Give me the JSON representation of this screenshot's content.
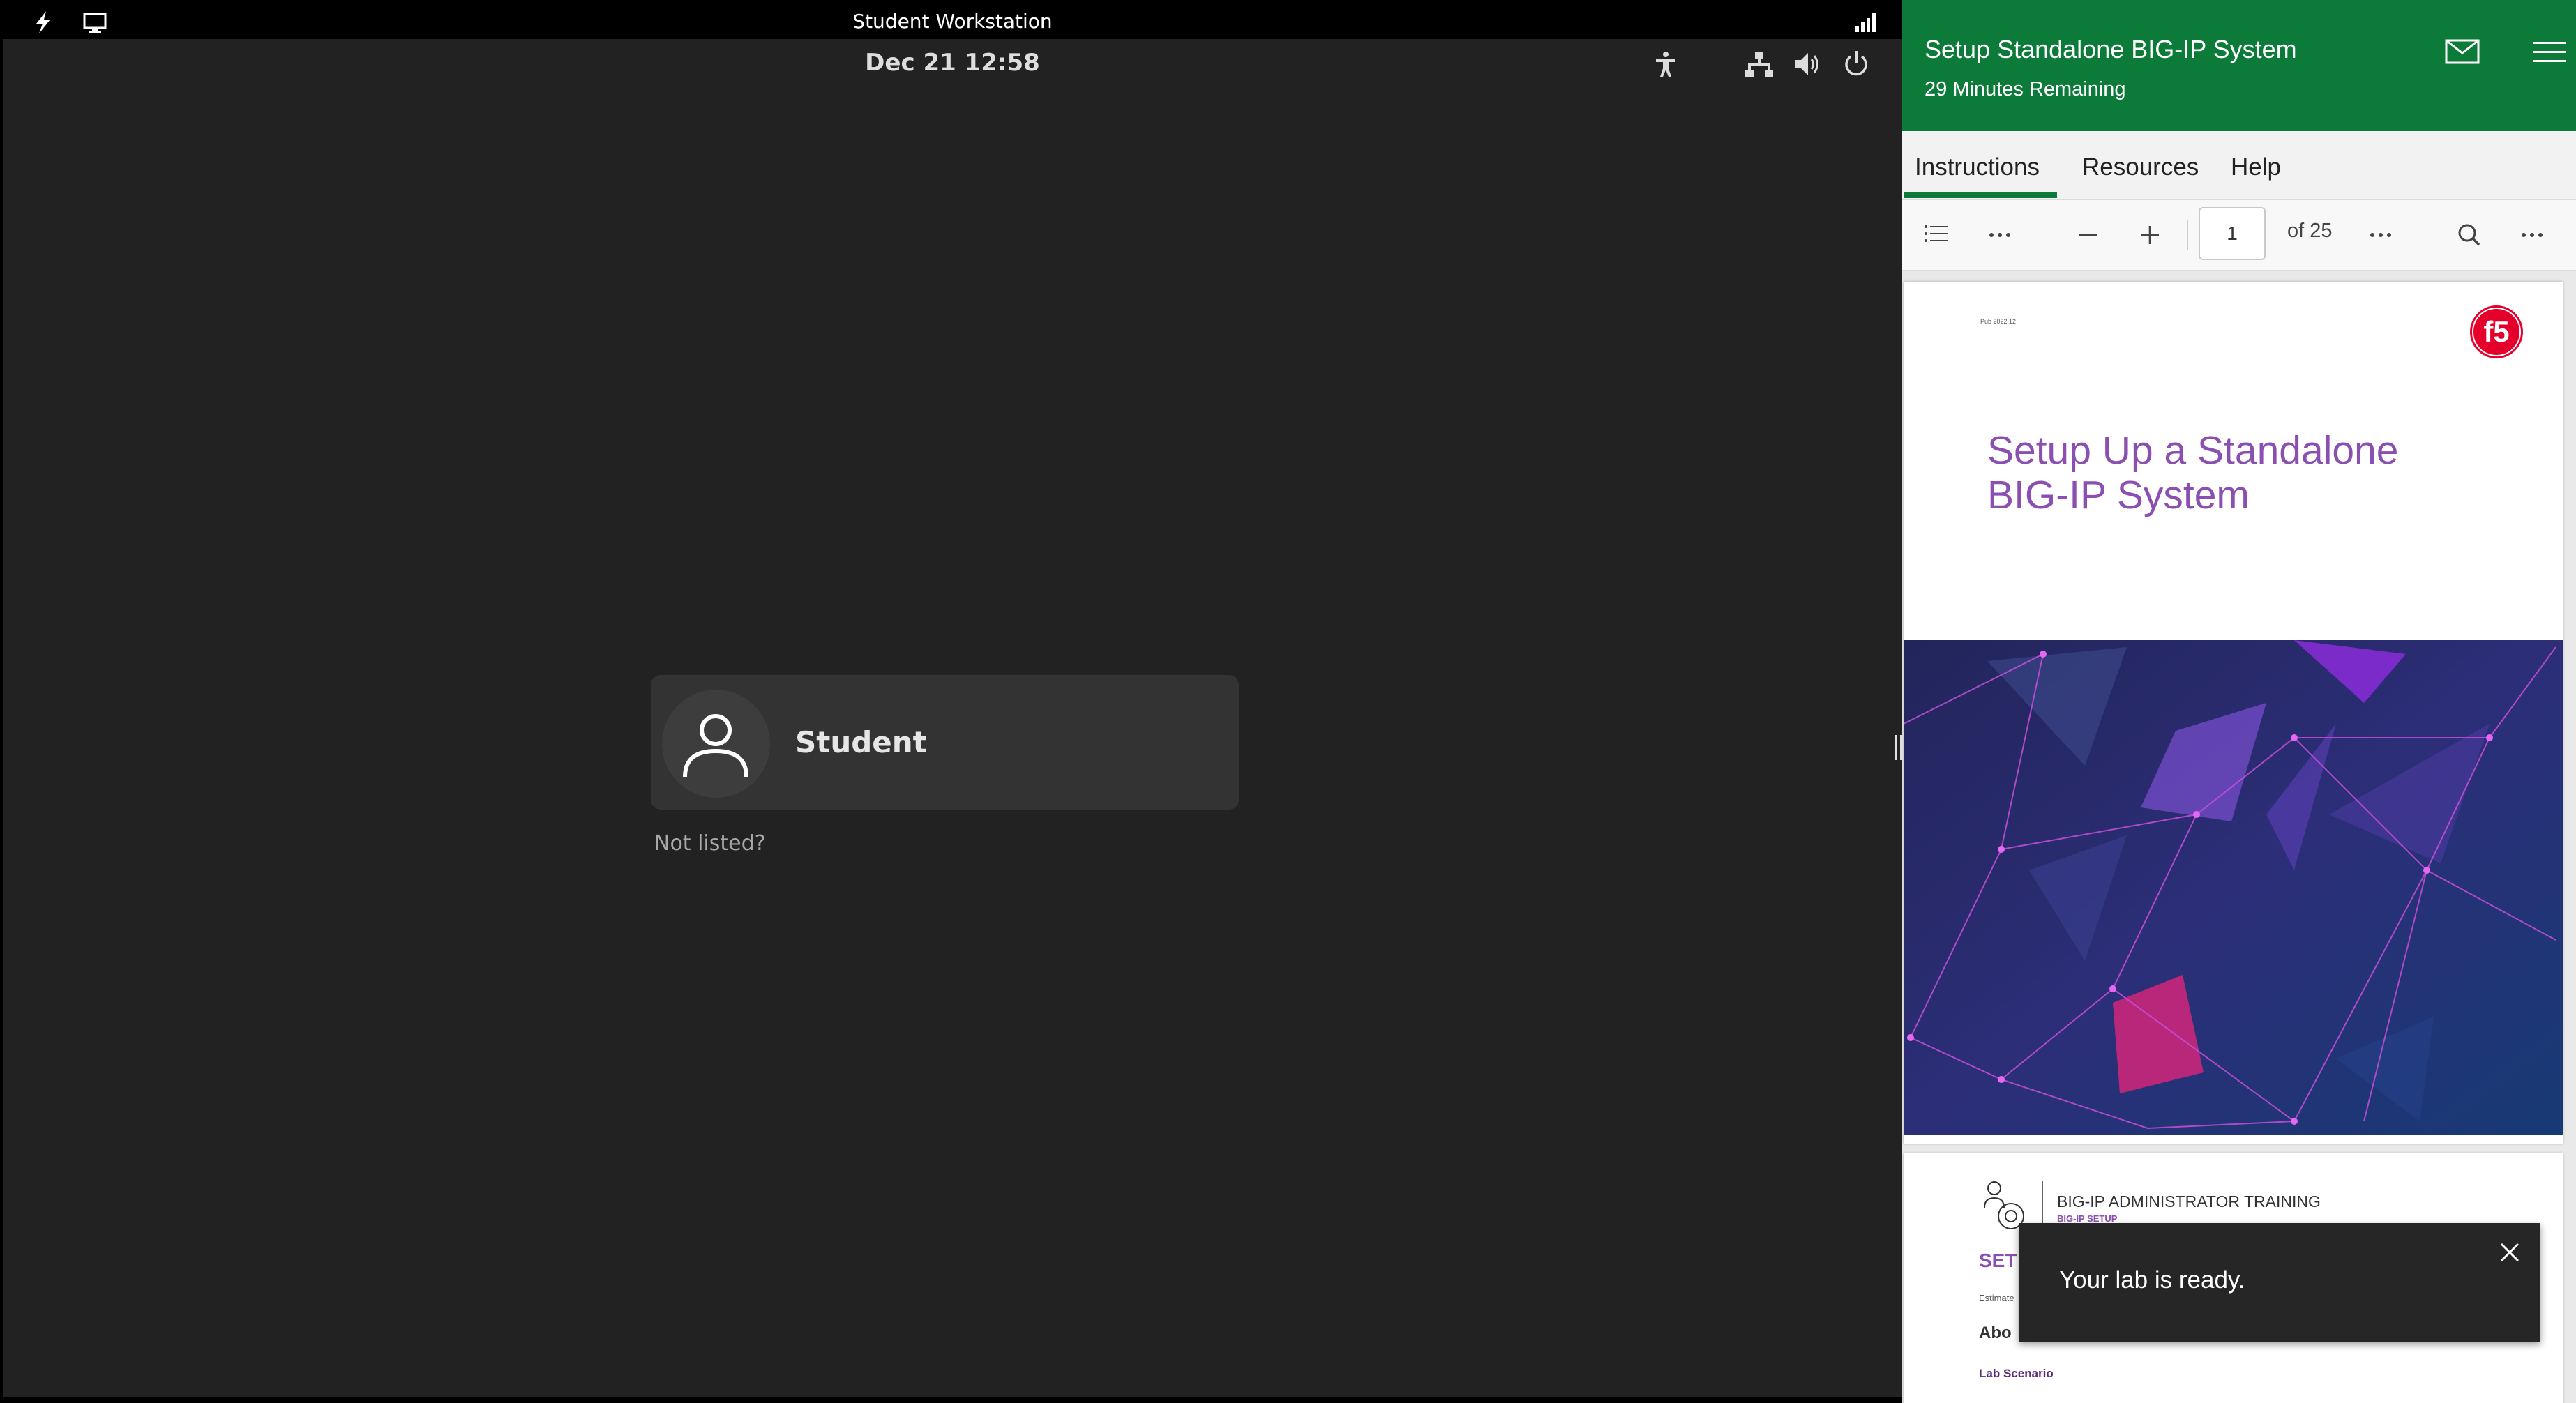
{
  "vm": {
    "window_title": "Student Workstation",
    "clock": "Dec 21  12:58",
    "user": {
      "name": "Student"
    },
    "not_listed": "Not listed?"
  },
  "lab": {
    "title": "Setup Standalone BIG-IP System",
    "time_remaining": "29 Minutes Remaining",
    "accent_color": "#0c7a38",
    "tabs": [
      {
        "label": "Instructions",
        "active": true
      },
      {
        "label": "Resources",
        "active": false
      },
      {
        "label": "Help",
        "active": false
      }
    ]
  },
  "pdf": {
    "current_page": "1",
    "page_count_label": "of 25",
    "page1": {
      "pub_date": "Pub 2022.12",
      "title_line1": "Setup Up a Standalone",
      "title_line2": "BIG-IP System",
      "logo": "f5"
    },
    "page2": {
      "course": "BIG-IP ADMINISTRATOR TRAINING",
      "course_sub": "BIG-IP SETUP",
      "heading_fragment": "SET",
      "estimated_fragment": "Estimate",
      "about_fragment": "Abo",
      "lab_scenario": "Lab Scenario"
    }
  },
  "toast": {
    "message": "Your lab is ready."
  },
  "icons": {
    "vm_topbar": [
      "lightning-icon",
      "display-icon",
      "signal-icon"
    ],
    "gnome": [
      "accessibility-icon",
      "network-icon",
      "volume-icon",
      "power-icon"
    ],
    "toolbar": [
      "contents-icon",
      "more-icon",
      "zoom-out-icon",
      "zoom-in-icon",
      "more-icon",
      "search-icon",
      "more-icon"
    ]
  }
}
